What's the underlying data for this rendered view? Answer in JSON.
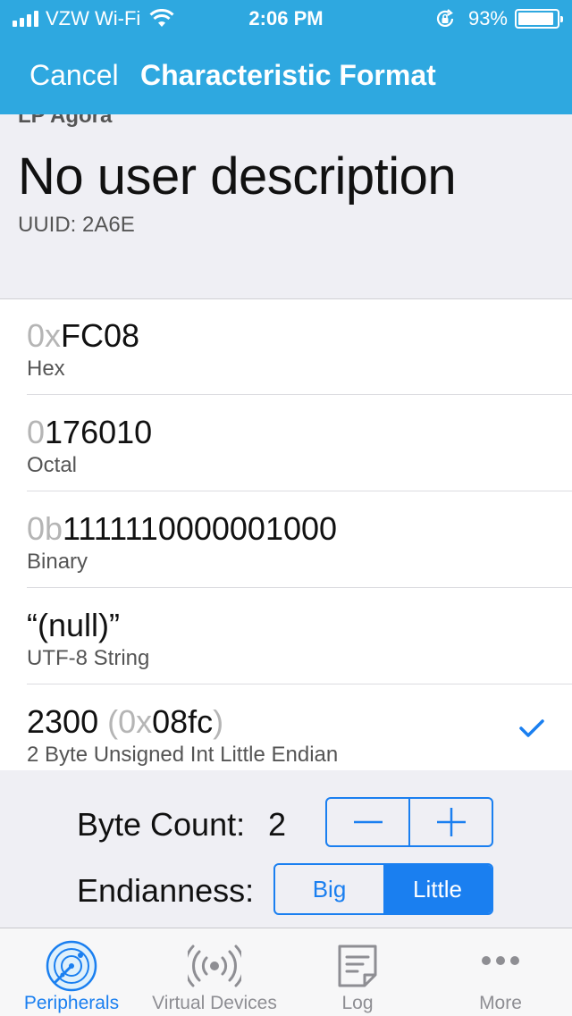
{
  "status_bar": {
    "carrier": "VZW Wi-Fi",
    "time": "2:06 PM",
    "battery": "93%",
    "battery_level": 0.93
  },
  "nav": {
    "cancel_label": "Cancel",
    "title": "Characteristic Format"
  },
  "info": {
    "service_name": "LP Agora",
    "user_description": "No user description",
    "uuid": "UUID: 2A6E"
  },
  "formats": [
    {
      "prefix": "0x",
      "value": "FC08",
      "label": "Hex",
      "selected": false
    },
    {
      "prefix": "0",
      "value": "176010",
      "label": "Octal",
      "selected": false
    },
    {
      "prefix": "0b",
      "value": "1111110000001000",
      "label": "Binary",
      "selected": false
    },
    {
      "quote_open": "“",
      "value": "(null)",
      "quote_close": "”",
      "label": "UTF-8 String",
      "selected": false
    },
    {
      "value": "2300",
      "paren_open": " (",
      "hex_prefix": "0x",
      "hex_value": "08fc",
      "paren_close": ")",
      "label": "2 Byte Unsigned Int Little Endian",
      "selected": true
    }
  ],
  "controls": {
    "byte_count_label": "Byte Count:",
    "byte_count_value": "2",
    "endianness_label": "Endianness:",
    "endianness_options": [
      "Big",
      "Little"
    ],
    "endianness_selected": "Little"
  },
  "tabs": [
    {
      "label": "Peripherals",
      "icon": "radar-icon",
      "active": true
    },
    {
      "label": "Virtual Devices",
      "icon": "broadcast-icon",
      "active": false
    },
    {
      "label": "Log",
      "icon": "log-icon",
      "active": false
    },
    {
      "label": "More",
      "icon": "more-icon",
      "active": false
    }
  ],
  "colors": {
    "nav_bar": "#2ea8e0",
    "accent": "#1a7ff0",
    "background": "#efeff4",
    "dim_text": "#b5b5b5"
  }
}
